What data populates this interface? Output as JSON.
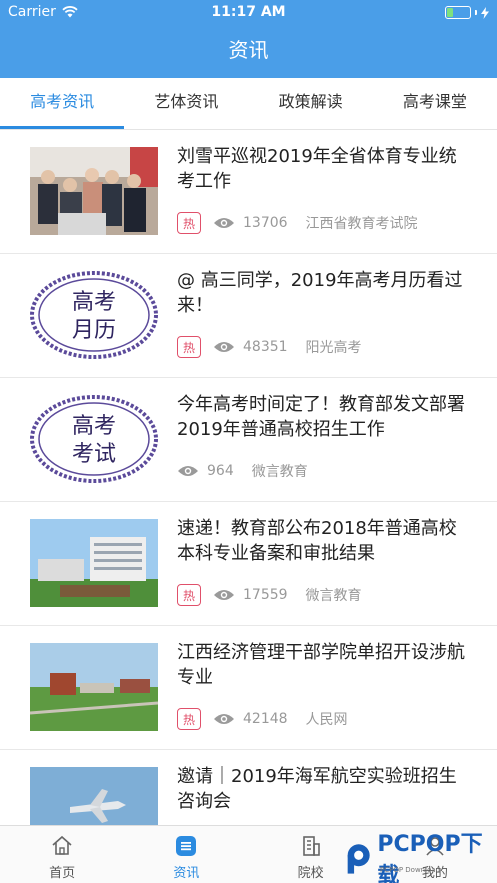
{
  "status_bar": {
    "carrier": "Carrier",
    "time": "11:17 AM"
  },
  "nav": {
    "title": "资讯"
  },
  "tabs": [
    {
      "label": "高考资讯",
      "active": true
    },
    {
      "label": "艺体资讯",
      "active": false
    },
    {
      "label": "政策解读",
      "active": false
    },
    {
      "label": "高考课堂",
      "active": false
    }
  ],
  "articles": [
    {
      "title": "刘雪平巡视2019年全省体育专业统考工作",
      "hot_label": "热",
      "views": "13706",
      "source": "江西省教育考试院",
      "thumb": "photo-people"
    },
    {
      "title": "@ 高三同学，2019年高考月历看过来！",
      "hot_label": "热",
      "views": "48351",
      "source": "阳光高考",
      "thumb": "stamp",
      "stamp_text": [
        "高考",
        "月历"
      ]
    },
    {
      "title": "今年高考时间定了！教育部发文部署2019年普通高校招生工作",
      "views": "964",
      "source": "微言教育",
      "thumb": "stamp",
      "stamp_text": [
        "高考",
        "考试"
      ]
    },
    {
      "title": "速递！教育部公布2018年普通高校本科专业备案和审批结果",
      "hot_label": "热",
      "views": "17559",
      "source": "微言教育",
      "thumb": "photo-campus"
    },
    {
      "title": "江西经济管理干部学院单招开设涉航专业",
      "hot_label": "热",
      "views": "42148",
      "source": "人民网",
      "thumb": "photo-aerial"
    },
    {
      "title": "邀请｜2019年海军航空实验班招生咨询会",
      "thumb": "photo-jet"
    }
  ],
  "tabbar": [
    {
      "label": "首页",
      "icon": "home-icon",
      "active": false
    },
    {
      "label": "资讯",
      "icon": "news-icon",
      "active": true
    },
    {
      "label": "院校",
      "icon": "building-icon",
      "active": false
    },
    {
      "label": "我的",
      "icon": "user-icon",
      "active": false
    }
  ],
  "watermark": {
    "text": "PCPOP下载",
    "sub": "PCPOP Download"
  },
  "colors": {
    "primary": "#4a9ee8",
    "accent": "#2b8be0",
    "hot": "#e0506a"
  }
}
